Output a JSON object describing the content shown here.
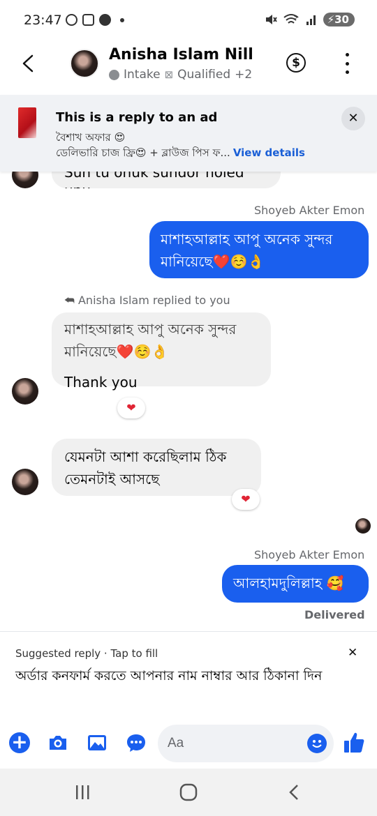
{
  "status_bar": {
    "time": "23:47",
    "battery": "30",
    "network": "5"
  },
  "header": {
    "name": "Anisha Islam Nill",
    "tag1": "Intake",
    "tag2": "Qualified",
    "extra_tags": "+2"
  },
  "ad_banner": {
    "title": "This is a reply to an ad",
    "line1": "বৈশাখ অফার 😍",
    "line2": "ডেলিভারি চাজ ফ্রি😍 + ব্লাউজ পিস ফ...",
    "link": "View details"
  },
  "messages": {
    "partial_top": "Sun tu onuk sundor holed upu",
    "sender_1": "Shoyeb Akter Emon",
    "out_1": "মাশাহআল্লাহ আপু অনেক সুন্দর মানিয়েছে❤️☺️👌",
    "reply_note": "Anisha Islam replied to you",
    "quoted": "মাশাহআল্লাহ আপু অনেক সুন্দর মানিয়েছে❤️☺️👌",
    "in_thanks": "Thank you",
    "reaction_1": "❤",
    "in_2": "যেমনটা আশা করেছিলাম ঠিক তেমনটাই আসছে",
    "reaction_2": "❤",
    "sender_2": "Shoyeb Akter Emon",
    "out_2": "আলহামদুলিল্লাহ 🥰",
    "delivered": "Delivered"
  },
  "suggested": {
    "label": "Suggested reply · Tap to fill",
    "text": "অর্ডার কনফার্ম করতে আপনার নাম নাম্বার আর ঠিকানা দিন"
  },
  "composer": {
    "placeholder": "Aa"
  },
  "colors": {
    "accent": "#1a5fee",
    "incoming_bubble": "#f0f0f0",
    "banner_bg": "#f0f2f5",
    "heart": "#e02434"
  }
}
